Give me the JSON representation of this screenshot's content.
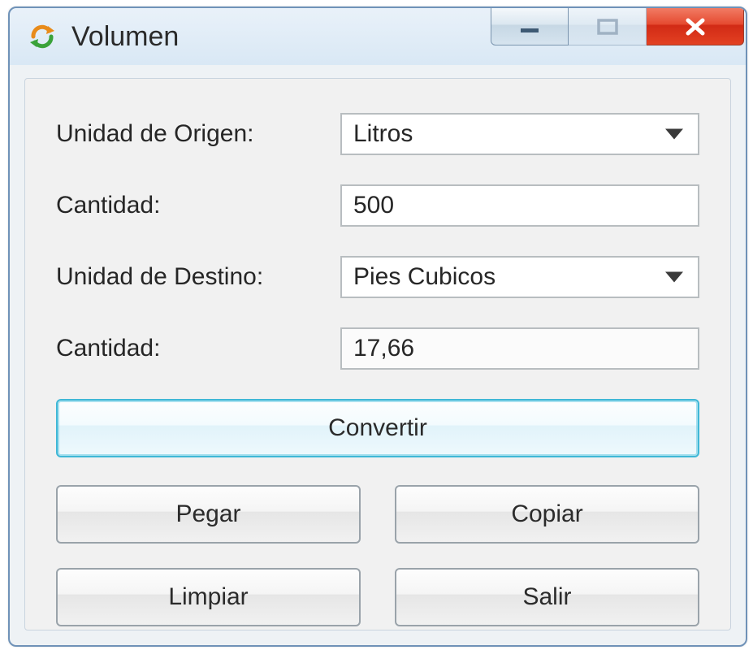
{
  "window": {
    "title": "Volumen"
  },
  "form": {
    "origin_unit_label": "Unidad de Origen:",
    "origin_unit_value": "Litros",
    "origin_qty_label": "Cantidad:",
    "origin_qty_value": "500",
    "dest_unit_label": "Unidad de Destino:",
    "dest_unit_value": "Pies Cubicos",
    "dest_qty_label": "Cantidad:",
    "dest_qty_value": "17,66"
  },
  "buttons": {
    "convert": "Convertir",
    "paste": "Pegar",
    "copy": "Copiar",
    "clear": "Limpiar",
    "exit": "Salir"
  }
}
